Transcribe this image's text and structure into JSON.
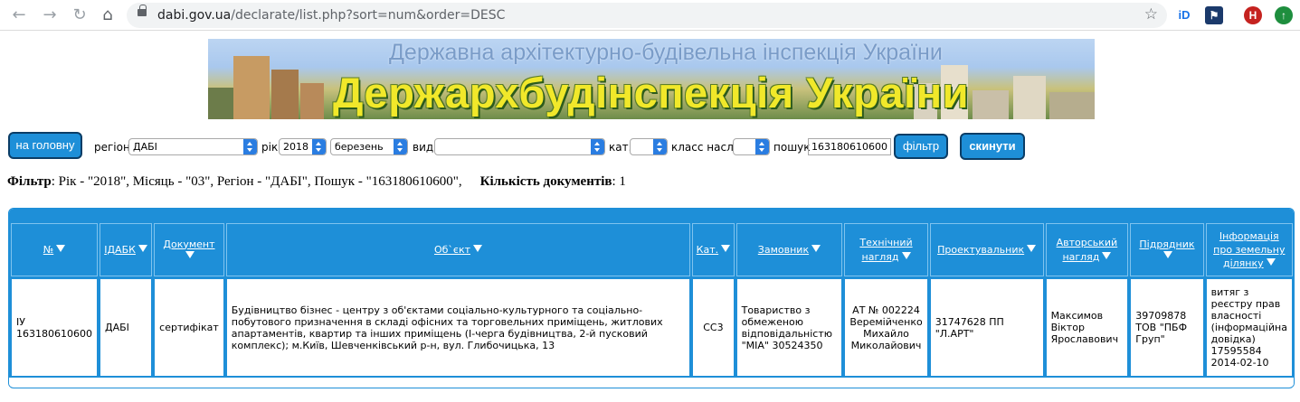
{
  "browser": {
    "url_domain": "dabi.gov.ua",
    "url_path": "/declarate/list.php?sort=num&order=DESC",
    "profile_initial": "H"
  },
  "banner": {
    "subtitle": "Державна архітектурно-будівельна інспекція України",
    "title": "Держархбудінспекція України"
  },
  "filters": {
    "home_button": "на головну",
    "region_label": "регіон",
    "region_value": "ДАБІ",
    "year_label": "рік",
    "year_value": "2018",
    "month_value": "березень",
    "type_label": "вид",
    "type_value": "",
    "cat_label": "кат.",
    "cat_value": "",
    "class_label": "класс насл.",
    "class_value": "",
    "search_label": "пошук",
    "search_value": "163180610600",
    "filter_button": "фільтр",
    "reset_button": "скинути"
  },
  "summary": {
    "filter_label": "Фільтр",
    "filter_text": ": Рік - \"2018\", Місяць - \"03\", Регіон - \"ДАБІ\", Пошук - \"163180610600\",",
    "count_label": "Кількість документів",
    "count_value": ": 1"
  },
  "table": {
    "columns": [
      {
        "label": "№"
      },
      {
        "label": "ІДАБК"
      },
      {
        "label": "Документ"
      },
      {
        "label": "Об`єкт"
      },
      {
        "label": "Кат."
      },
      {
        "label": "Замовник"
      },
      {
        "label": "Технічний нагляд"
      },
      {
        "label": "Проектувальник"
      },
      {
        "label": "Авторський нагляд"
      },
      {
        "label": "Підрядник"
      },
      {
        "label": "Інформація про земельну ділянку"
      }
    ],
    "rows": [
      {
        "num": "ІУ 163180610600",
        "idabk": "ДАБІ",
        "document": "сертифікат",
        "object": "Будівництво бізнес - центру з об'єктами соціально-культурного та соціально-побутового призначення в складі офісних та торговельних приміщень, житлових апартаментів, квартир та інших приміщень (І-черга будівництва, 2-й пусковий комплекс); м.Київ, Шевченківський р-н, вул. Глибочицька, 13",
        "cat": "СС3",
        "customer": "Товариство з обмеженою відповідальністю \"МІА\" 30524350",
        "tech_supervision": "АТ № 002224 Веремійченко Михайло Миколайович",
        "designer": "31747628 ПП \"Л.АРТ\"",
        "author_supervision": "Максимов Віктор Ярославович",
        "contractor": "39709878 ТОВ \"ПБФ Груп\"",
        "land_info": "витяг з реєстру прав власності (інформаційна довідка) 17595584 2014-02-10"
      }
    ]
  },
  "colors": {
    "accent": "#1e8fd8",
    "button_border": "#0b3d66"
  }
}
